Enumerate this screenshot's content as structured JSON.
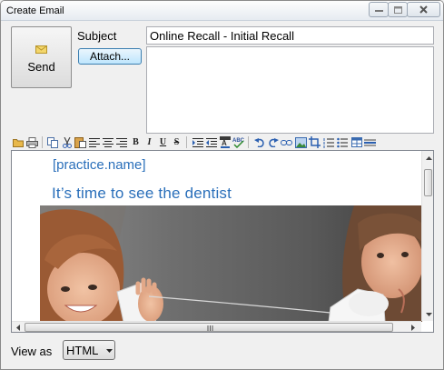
{
  "window": {
    "title": "Create Email"
  },
  "compose": {
    "send_label": "Send",
    "subject_label": "Subject",
    "subject_value": "Online Recall - Initial Recall",
    "attach_label": "Attach..."
  },
  "toolbar": {
    "bold_glyph": "B",
    "italic_glyph": "I",
    "underline_glyph": "U",
    "strike_glyph": "S",
    "icons": [
      "open-folder-icon",
      "print-icon",
      "copy-icon",
      "cut-icon",
      "paste-icon",
      "align-left-icon",
      "align-center-icon",
      "align-right-icon",
      "bold-icon",
      "italic-icon",
      "underline-icon",
      "strikethrough-icon",
      "indent-icon",
      "outdent-icon",
      "font-color-icon",
      "spell-check-icon",
      "undo-icon",
      "redo-icon",
      "link-icon",
      "image-icon",
      "crop-icon",
      "numbered-list-icon",
      "bulleted-list-icon",
      "table-icon",
      "horizontal-rule-icon"
    ]
  },
  "editor": {
    "practice_name": "[practice.name]",
    "headline": "It’s time to see the dentist",
    "text_color": "#2a6fba"
  },
  "footer": {
    "view_as_label": "View as",
    "view_as_value": "HTML"
  }
}
